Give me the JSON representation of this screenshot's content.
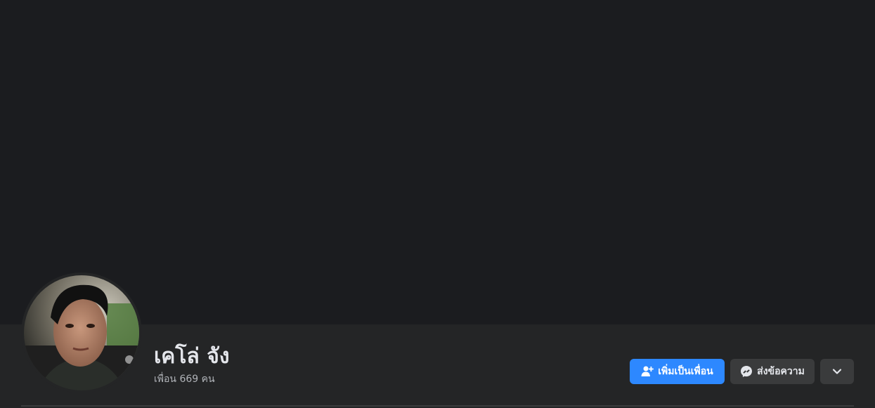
{
  "profile": {
    "name": "เคโล่ จัง",
    "friends_count_text": "เพื่อน 669 คน"
  },
  "actions": {
    "add_friend_label": "เพิ่มเป็นเพื่อน",
    "message_label": "ส่งข้อความ"
  },
  "icons": {
    "add_friend": "add-user-icon",
    "message": "messenger-icon",
    "more": "chevron-down-icon"
  },
  "colors": {
    "accent": "#2d88ff",
    "background": "#18191a",
    "surface": "#242526",
    "button_secondary": "#3a3b3c",
    "text_primary": "#e4e6eb",
    "text_secondary": "#b0b3b8"
  }
}
